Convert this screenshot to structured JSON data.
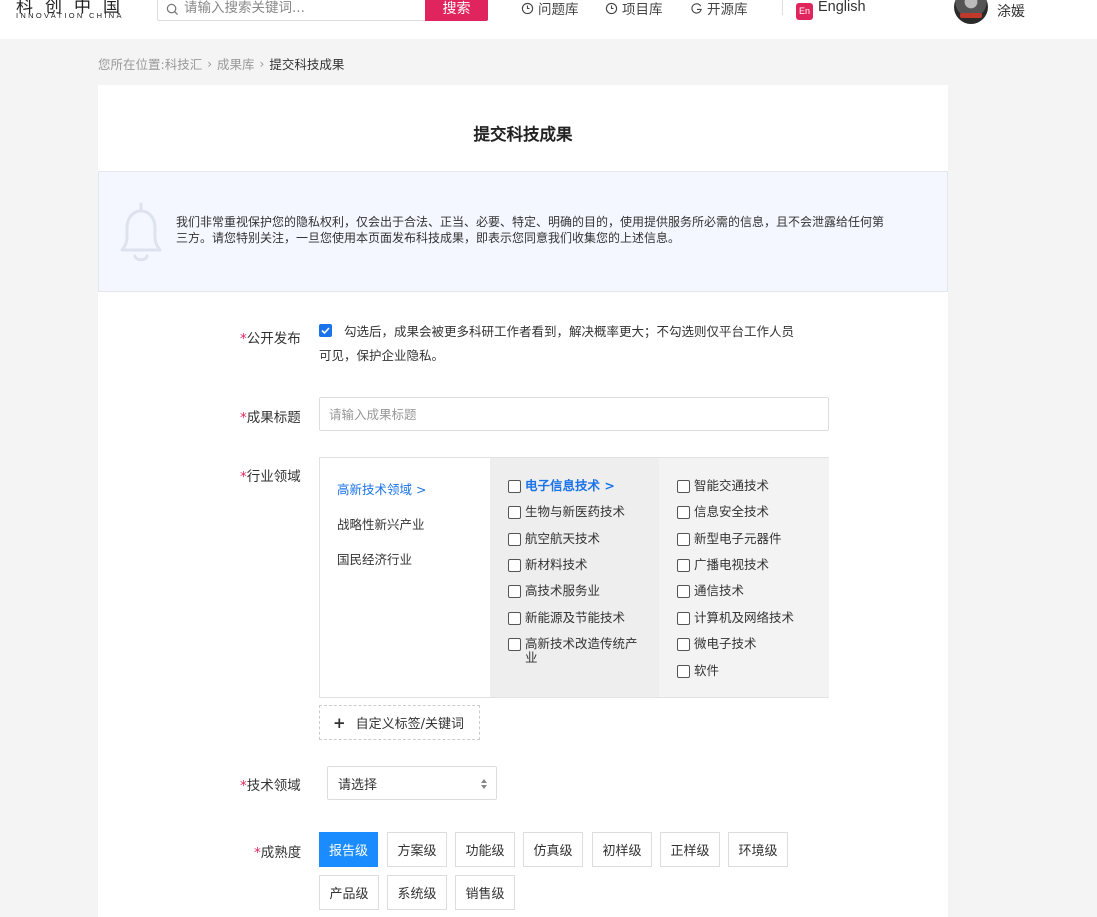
{
  "header": {
    "logo_cn": "科创中国",
    "logo_en": "INNOVATION CHINA",
    "search_placeholder": "请输入搜索关键词...",
    "search_button": "搜索",
    "nav": [
      "问题库",
      "项目库",
      "开源库"
    ],
    "lang_badge": "En",
    "lang_label": "English",
    "user_name": "涂媛"
  },
  "breadcrumb": {
    "prefix": "您所在位置:科技汇",
    "items": [
      "成果库",
      "提交科技成果"
    ]
  },
  "form": {
    "title": "提交科技成果",
    "notice": "我们非常重视保护您的隐私权利，仅会出于合法、正当、必要、特定、明确的目的，使用提供服务所必需的信息，且不会泄露给任何第三方。请您特别关注，一旦您使用本页面发布科技成果，即表示您同意我们收集您的上述信息。",
    "public_label": "公开发布",
    "public_checked": true,
    "public_text": "勾选后，成果会被更多科研工作者看到，解决概率更大；不勾选则仅平台工作人员可见，保护企业隐私。",
    "title_label": "成果标题",
    "title_placeholder": "请输入成果标题",
    "industry_label": "行业领域",
    "industry_categories": [
      "高新技术领域 >",
      "战略性新兴产业",
      "国民经济行业"
    ],
    "industry_col2": [
      "电子信息技术 >",
      "生物与新医药技术",
      "航空航天技术",
      "新材料技术",
      "高技术服务业",
      "新能源及节能技术",
      "高新技术改造传统产业"
    ],
    "industry_col3": [
      "智能交通技术",
      "信息安全技术",
      "新型电子元器件",
      "广播电视技术",
      "通信技术",
      "计算机及网络技术",
      "微电子技术",
      "软件"
    ],
    "custom_tag": "自定义标签/关键词",
    "tech_label": "技术领域",
    "tech_select": "请选择",
    "maturity_label": "成熟度",
    "maturity_levels": [
      "报告级",
      "方案级",
      "功能级",
      "仿真级",
      "初样级",
      "正样级",
      "环境级",
      "产品级",
      "系统级",
      "销售级"
    ],
    "maturity_selected": "报告级"
  }
}
